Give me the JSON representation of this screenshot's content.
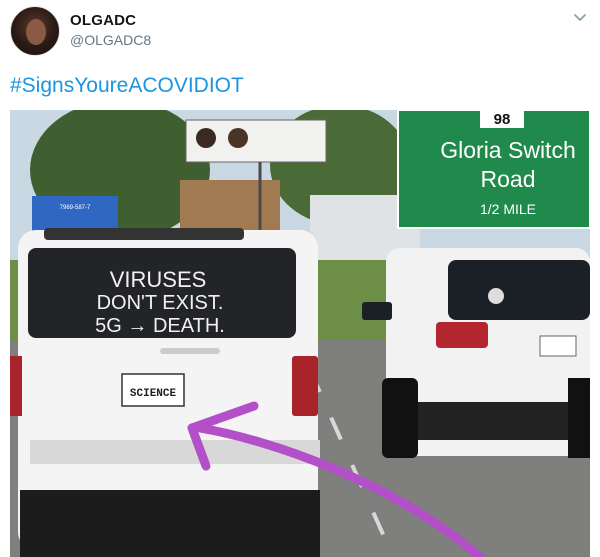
{
  "tweet": {
    "display_name": "OLGADC",
    "handle": "@OLGADC8",
    "hashtag": "#SignsYoureACOVIDIOT"
  },
  "photo": {
    "sign": {
      "route_number": "98",
      "line1": "Gloria Switch",
      "line2": "Road",
      "distance": "1/2 MILE"
    },
    "window_text": {
      "line1": "VIRUSES",
      "line2": "DON'T EXIST.",
      "line3": "5G → DEATH."
    },
    "license_plate": "SCIENCE",
    "small_sign_text": "7969-587-7"
  },
  "icons": {
    "menu": "chevron-down-icon",
    "arrow": "purple-arrow"
  },
  "colors": {
    "link": "#1b95e0",
    "highway_sign": "#1f8a4c",
    "arrow": "#b34fc8"
  }
}
